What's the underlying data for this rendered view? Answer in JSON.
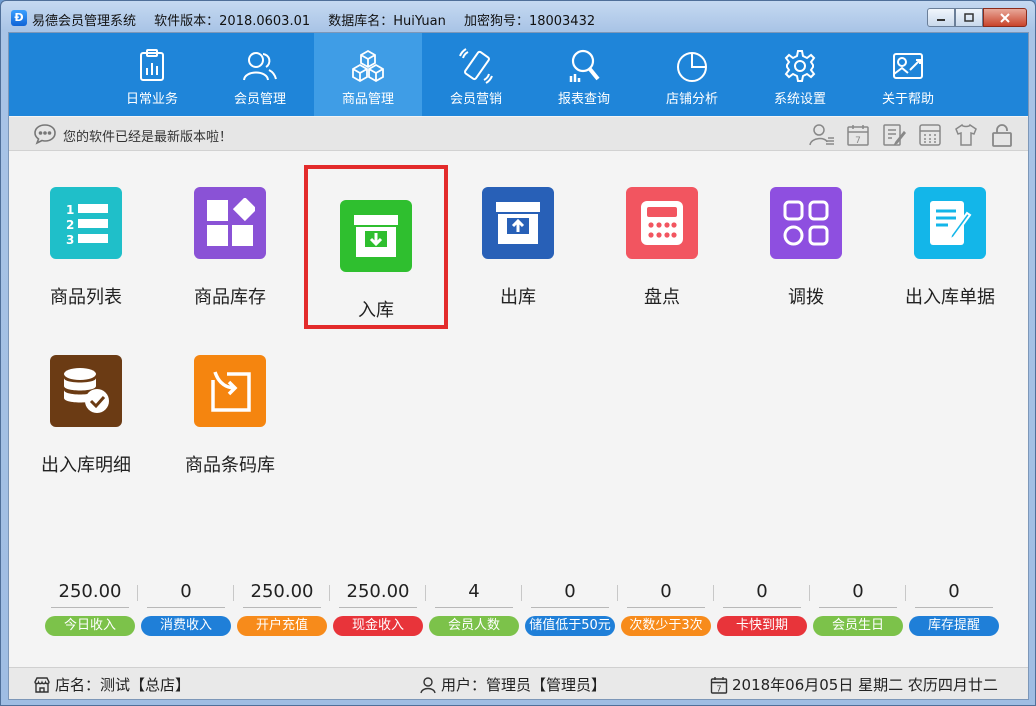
{
  "titlebar": {
    "app_name": "易德会员管理系统",
    "version": "软件版本：2018.0603.01",
    "database": "数据库名：HuiYuan",
    "dongle": "加密狗号：18003432",
    "icon_letter": "Ꙫ"
  },
  "nav": {
    "items": [
      {
        "label": "日常业务",
        "icon": "clipboard-chart-icon"
      },
      {
        "label": "会员管理",
        "icon": "users-icon"
      },
      {
        "label": "商品管理",
        "icon": "cubes-icon"
      },
      {
        "label": "会员营销",
        "icon": "phone-icon"
      },
      {
        "label": "报表查询",
        "icon": "report-search-icon"
      },
      {
        "label": "店铺分析",
        "icon": "pie-chart-icon"
      },
      {
        "label": "系统设置",
        "icon": "gear-icon"
      },
      {
        "label": "关于帮助",
        "icon": "help-icon"
      }
    ],
    "active": "商品管理"
  },
  "infobar": {
    "message": "您的软件已经是最新版本啦！"
  },
  "tiles": [
    {
      "label": "商品列表",
      "color": "#1fbfc9"
    },
    {
      "label": "商品库存",
      "color": "#8a52d6"
    },
    {
      "label": "入库",
      "color": "#2fbf2f"
    },
    {
      "label": "出库",
      "color": "#2860b7"
    },
    {
      "label": "盘点",
      "color": "#f25560"
    },
    {
      "label": "调拨",
      "color": "#8e4fe0"
    },
    {
      "label": "出入库单据",
      "color": "#13b6e9"
    },
    {
      "label": "出入库明细",
      "color": "#6b3b14"
    },
    {
      "label": "商品条码库",
      "color": "#f5850f"
    }
  ],
  "stats": [
    {
      "value": "250.00",
      "label": "今日收入",
      "color": "#7cc24a"
    },
    {
      "value": "0",
      "label": "消费收入",
      "color": "#1f7fd8"
    },
    {
      "value": "250.00",
      "label": "开户充值",
      "color": "#f78b1b"
    },
    {
      "value": "250.00",
      "label": "现金收入",
      "color": "#e8343a"
    },
    {
      "value": "4",
      "label": "会员人数",
      "color": "#7cc24a"
    },
    {
      "value": "0",
      "label": "储值低于50元",
      "color": "#1f7fd8"
    },
    {
      "value": "0",
      "label": "次数少于3次",
      "color": "#f78b1b"
    },
    {
      "value": "0",
      "label": "卡快到期",
      "color": "#e8343a"
    },
    {
      "value": "0",
      "label": "会员生日",
      "color": "#7cc24a"
    },
    {
      "value": "0",
      "label": "库存提醒",
      "color": "#1f7fd8"
    }
  ],
  "statusbar": {
    "store": "店名：测试【总店】",
    "user": "用户：管理员【管理员】",
    "date": "2018年06月05日 星期二 农历四月廿二"
  },
  "calendar_day": "7"
}
